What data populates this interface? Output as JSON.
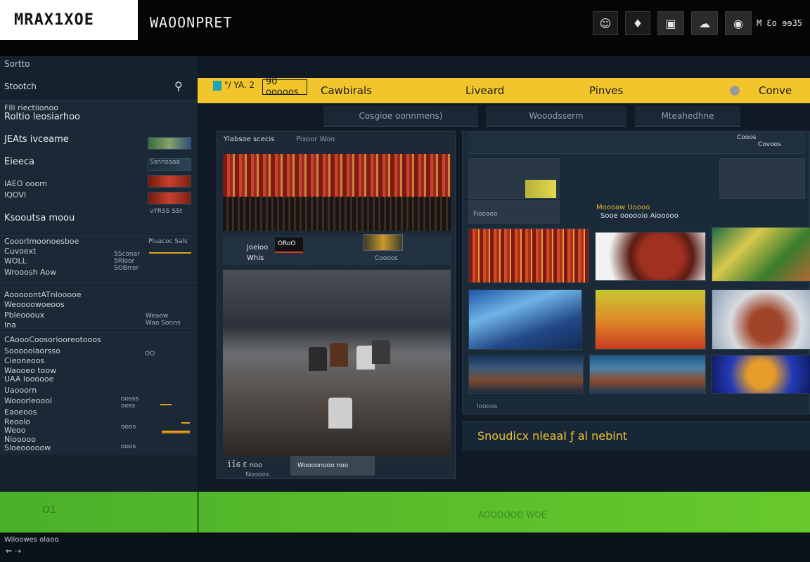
{
  "topbar": {
    "logo": "MRAX1XOE",
    "title": "WAOONPRET",
    "icons": [
      "user-icon",
      "diamond-icon",
      "image-icon",
      "cloud-icon",
      "dish-icon"
    ],
    "user_label": "M Ɛo ɘɘ35"
  },
  "sidebar": {
    "header": "Sortto",
    "search_label": "Stootch",
    "sections": [
      {
        "rows": [
          "Flli riectiionoo",
          "Roltio leosiarhoo",
          "JEAts ivceame",
          "Eieeca",
          "IAEO ooom",
          "IQOVI",
          "Ksooutsa moou"
        ],
        "tags": [
          "Ssnnsaaa",
          "vYRSS SSt"
        ]
      },
      {
        "rows": [
          "Cooorlmoonoesboe",
          "Cuvoext",
          "WOLL",
          "Wrooosh Aow"
        ],
        "tags": [
          "Pluacoc Sals",
          "5Sconar",
          "5Rloor",
          "SOBrrer"
        ]
      },
      {
        "rows": [
          "AooooontATnIooooe",
          "Weoooowoeoos",
          "Pbleoooux",
          "Ina"
        ],
        "tags": [
          "Weaow",
          "Wao Sonns"
        ]
      },
      {
        "rows": [
          "CAoooCoosoriooreotooos",
          "Sooooolaorsso",
          "Cieoneoos",
          "Waooeo toow",
          "UAA loooooe",
          "Uaooorn",
          "Wooorleoool",
          "Eaoeoos",
          "Reoolo",
          "Weoo",
          "Niooooo",
          "Sloeooooow"
        ],
        "tags": [
          "OO",
          "oosss",
          "ooss",
          "ooos",
          "ooos"
        ]
      }
    ]
  },
  "yellowbar": {
    "small_label": "\"/ YA. 2",
    "box_label": "90 ooooos",
    "nav": [
      "Cawbirals",
      "Liveard",
      "Pinves",
      "Conve"
    ]
  },
  "subtabs": [
    "Cosgioe oonnmens)",
    "Wooodsserm",
    "Mteahedhne"
  ],
  "left_panel": {
    "header": "Ylabsoe scecis",
    "header2": "Pixoor Woo",
    "strip_line1": "Joeioo",
    "strip_line2": "Whis",
    "chip": "ORoO",
    "thumb_label": "Coooos",
    "footer_line1": "1̄1̄6 Ɛ noo",
    "footer_line2": "Noooos",
    "footer_button": "Woooonooo noo"
  },
  "right_panel": {
    "header_tag": "Cooos",
    "header_tag2": "Covoos",
    "sub_title": "Moooaw Uoooo",
    "sub_line": "Sooe oooooio Aiooooo",
    "small_label": "Fiooaoo",
    "footer": "loooos"
  },
  "banner": {
    "text": "Snoudicx nleaaI ƒ al nebint"
  },
  "greenband": {
    "left_text": "O1",
    "right_text": "AOOOOOO WOE"
  },
  "statusbar": {
    "line1": "Wiloowes olaoo",
    "line2": "⇐ ⇢"
  },
  "colors": {
    "accent_yellow": "#f1c52b",
    "banner_text": "#f0c238",
    "green": "#5bbd2a",
    "background": "#0d1620"
  }
}
